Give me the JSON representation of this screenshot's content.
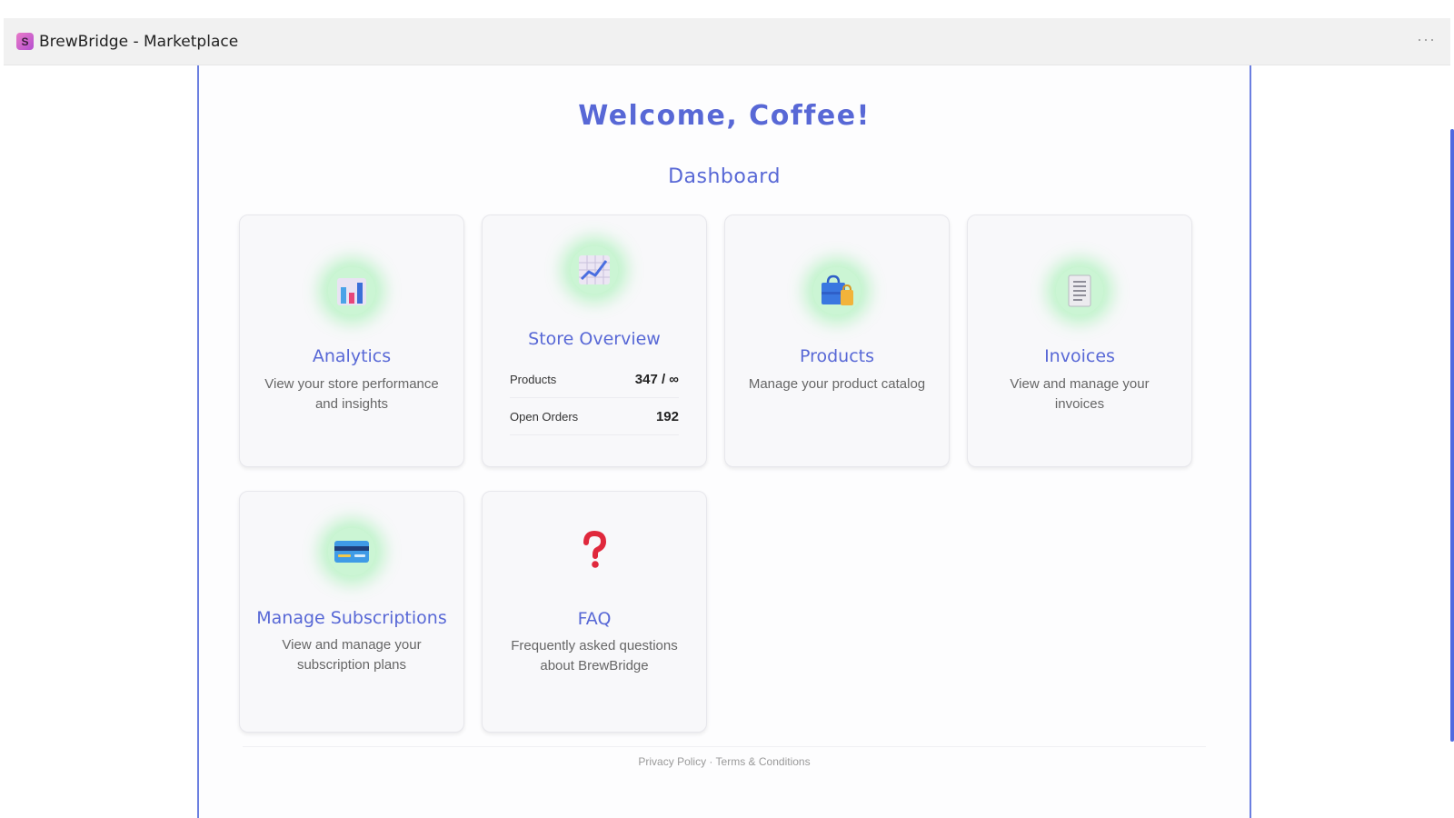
{
  "window": {
    "title": "BrewBridge - Marketplace",
    "app_icon_glyph": "S",
    "more_label": "···"
  },
  "header": {
    "welcome": "Welcome, Coffee!",
    "section_title": "Dashboard"
  },
  "cards": {
    "analytics": {
      "icon": "bar-chart-icon",
      "title": "Analytics",
      "desc": "View your store performance and insights"
    },
    "store_overview": {
      "icon": "line-chart-icon",
      "title": "Store Overview",
      "stats": [
        {
          "label": "Products",
          "value": "347 / ∞"
        },
        {
          "label": "Open Orders",
          "value": "192"
        }
      ]
    },
    "products": {
      "icon": "shopping-bags-icon",
      "title": "Products",
      "desc": "Manage your product catalog"
    },
    "invoices": {
      "icon": "receipt-icon",
      "title": "Invoices",
      "desc": "View and manage your invoices"
    },
    "subscriptions": {
      "icon": "credit-card-icon",
      "title": "Manage Subscriptions",
      "desc": "View and manage your subscription plans"
    },
    "faq": {
      "icon": "question-mark-icon",
      "title": "FAQ",
      "desc": "Frequently asked questions about BrewBridge"
    }
  },
  "footer": {
    "privacy": "Privacy Policy",
    "separator": "·",
    "terms": "Terms & Conditions"
  },
  "colors": {
    "accent": "#5868d6",
    "border_accent": "#6b7fe0",
    "icon_glow": "#50eb6e"
  }
}
